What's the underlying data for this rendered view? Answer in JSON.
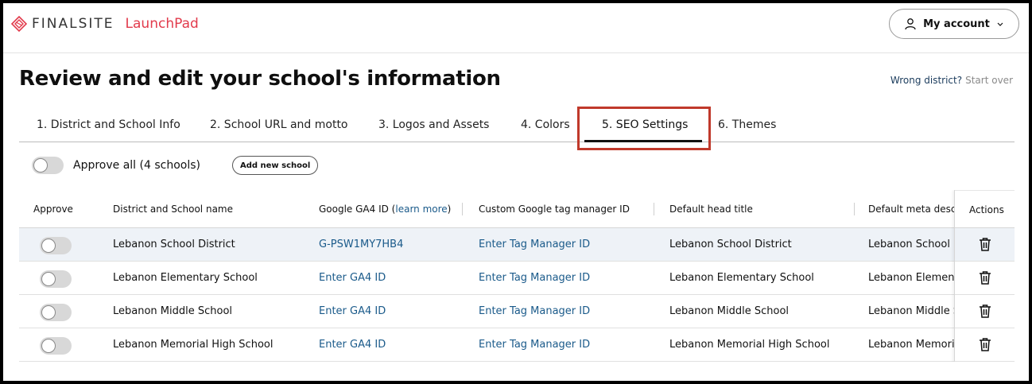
{
  "header": {
    "brand": "FINALSITE",
    "product": "LaunchPad",
    "account_label": "My account",
    "brand_color": "#e23b4c"
  },
  "page": {
    "title": "Review and edit your school's information",
    "wrong_district": "Wrong district?",
    "start_over": "Start over"
  },
  "tabs": [
    {
      "label": "1. District and School Info"
    },
    {
      "label": "2. School URL and motto"
    },
    {
      "label": "3. Logos and Assets"
    },
    {
      "label": "4. Colors"
    },
    {
      "label": "5. SEO Settings",
      "active": true
    },
    {
      "label": "6. Themes"
    }
  ],
  "toolbar": {
    "approve_all": "Approve all (4 schools)",
    "add_school": "Add new school"
  },
  "table": {
    "columns": {
      "approve": "Approve",
      "name": "District and School name",
      "ga4": "Google GA4 ID (",
      "ga4_link": "learn more",
      "ga4_close": ")",
      "gtm": "Custom Google tag manager ID",
      "head_title": "Default head title",
      "meta_desc": "Default meta desc",
      "actions": "Actions"
    },
    "rows": [
      {
        "name": "Lebanon School District",
        "ga4": "G-PSW1MY7HB4",
        "gtm": "Enter Tag Manager ID",
        "head_title": "Lebanon School District",
        "meta_desc": "Lebanon School D"
      },
      {
        "name": "Lebanon Elementary School",
        "ga4": "Enter GA4 ID",
        "gtm": "Enter Tag Manager ID",
        "head_title": "Lebanon Elementary School",
        "meta_desc": "Lebanon Elemen"
      },
      {
        "name": "Lebanon Middle School",
        "ga4": "Enter GA4 ID",
        "gtm": "Enter Tag Manager ID",
        "head_title": "Lebanon Middle School",
        "meta_desc": "Lebanon Middle S"
      },
      {
        "name": "Lebanon Memorial High School",
        "ga4": "Enter GA4 ID",
        "gtm": "Enter Tag Manager ID",
        "head_title": "Lebanon Memorial High School",
        "meta_desc": "Lebanon Memori"
      }
    ]
  },
  "icons": {
    "logo": "finalsite-diamond-icon",
    "account": "user-icon",
    "chevron": "chevron-down-icon",
    "delete": "trash-icon"
  }
}
